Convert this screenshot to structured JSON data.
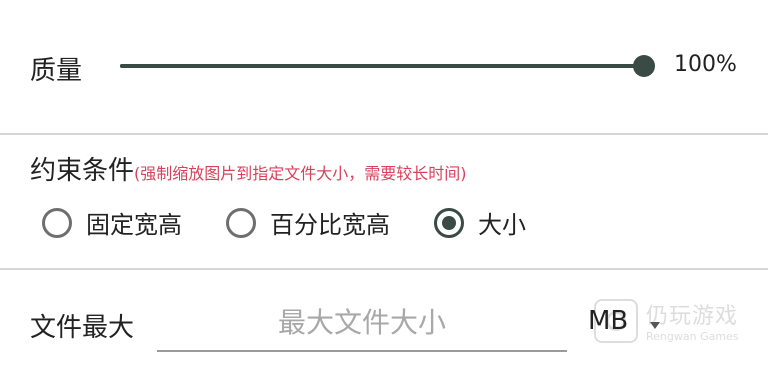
{
  "quality": {
    "label": "质量",
    "value_text": "100%",
    "value": 1.0
  },
  "constraint": {
    "label": "约束条件",
    "hint": "(强制缩放图片到指定文件大小，需要较长时间)",
    "options": [
      {
        "label": "固定宽高",
        "selected": false
      },
      {
        "label": "百分比宽高",
        "selected": false
      },
      {
        "label": "大小",
        "selected": true
      }
    ]
  },
  "max_size": {
    "label": "文件最大",
    "placeholder": "最大文件大小",
    "value": "",
    "unit": "MB"
  },
  "watermark": {
    "cn": "仍玩游戏",
    "en": "Rengwan Games"
  },
  "colors": {
    "accent": "#3a4a44",
    "hint": "#d9415b",
    "divider": "#d6d6d6"
  }
}
